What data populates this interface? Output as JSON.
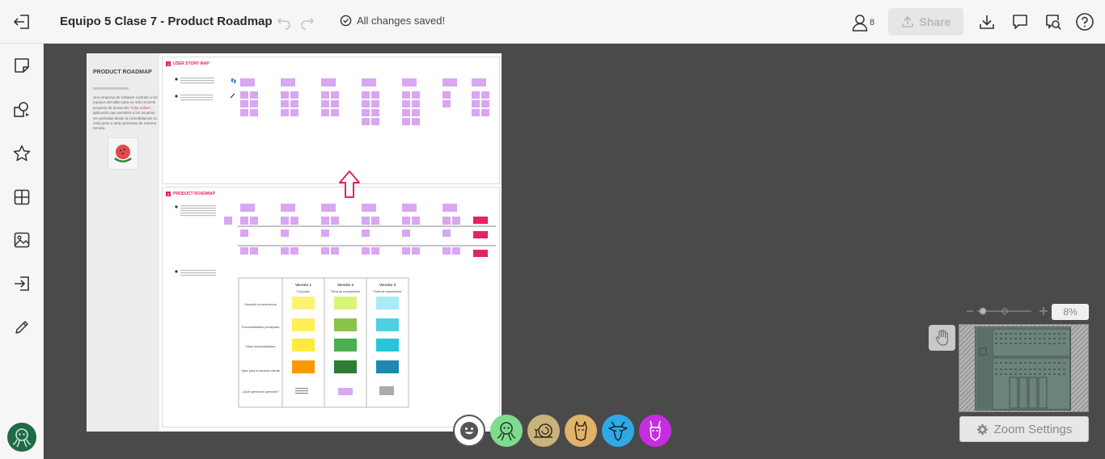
{
  "header": {
    "title": "Equipo 5 Clase 7 - Product Roadmap",
    "save_status": "All changes saved!",
    "user_count": "8",
    "share_label": "Share"
  },
  "board": {
    "title": "PRODUCT ROADMAP",
    "description": "Una empresa de software contrató a los equipos del taller para su más reciente proyecto de desarrollo",
    "description_em": "\"Cine online\"",
    "description_tail": ", aplicación que permitirá a los usuarios ver películas desde la comodidad de su casa junto a otras personas de manera remota.",
    "section1_num": "1",
    "section1_title": "USER STORY MAP",
    "section2_num": "2",
    "section2_title": "PRODUCT ROADMAP",
    "versions": [
      "Versión 1",
      "Versión 2",
      "Versión 3"
    ],
    "version_names": [
      "\"Cupcake\"",
      "\"Torta de cumpleaños\"",
      "\"Torta de casamiento\""
    ],
    "row_labels": [
      "Describir la experiencia",
      "Funcionalidades principales",
      "Otras funcionalidades",
      "Valor para el usuario/ cliente",
      "¿Qué queremos aprender?"
    ]
  },
  "zoom": {
    "percent": "8%",
    "settings_label": "Zoom Settings"
  },
  "colors": {
    "accent": "#e3245e",
    "sticky_purple": "#d9a6f2",
    "sticky_yellow": "#fff176",
    "sticky_green": "#4caf50",
    "sticky_cyan": "#4dd0e1"
  }
}
